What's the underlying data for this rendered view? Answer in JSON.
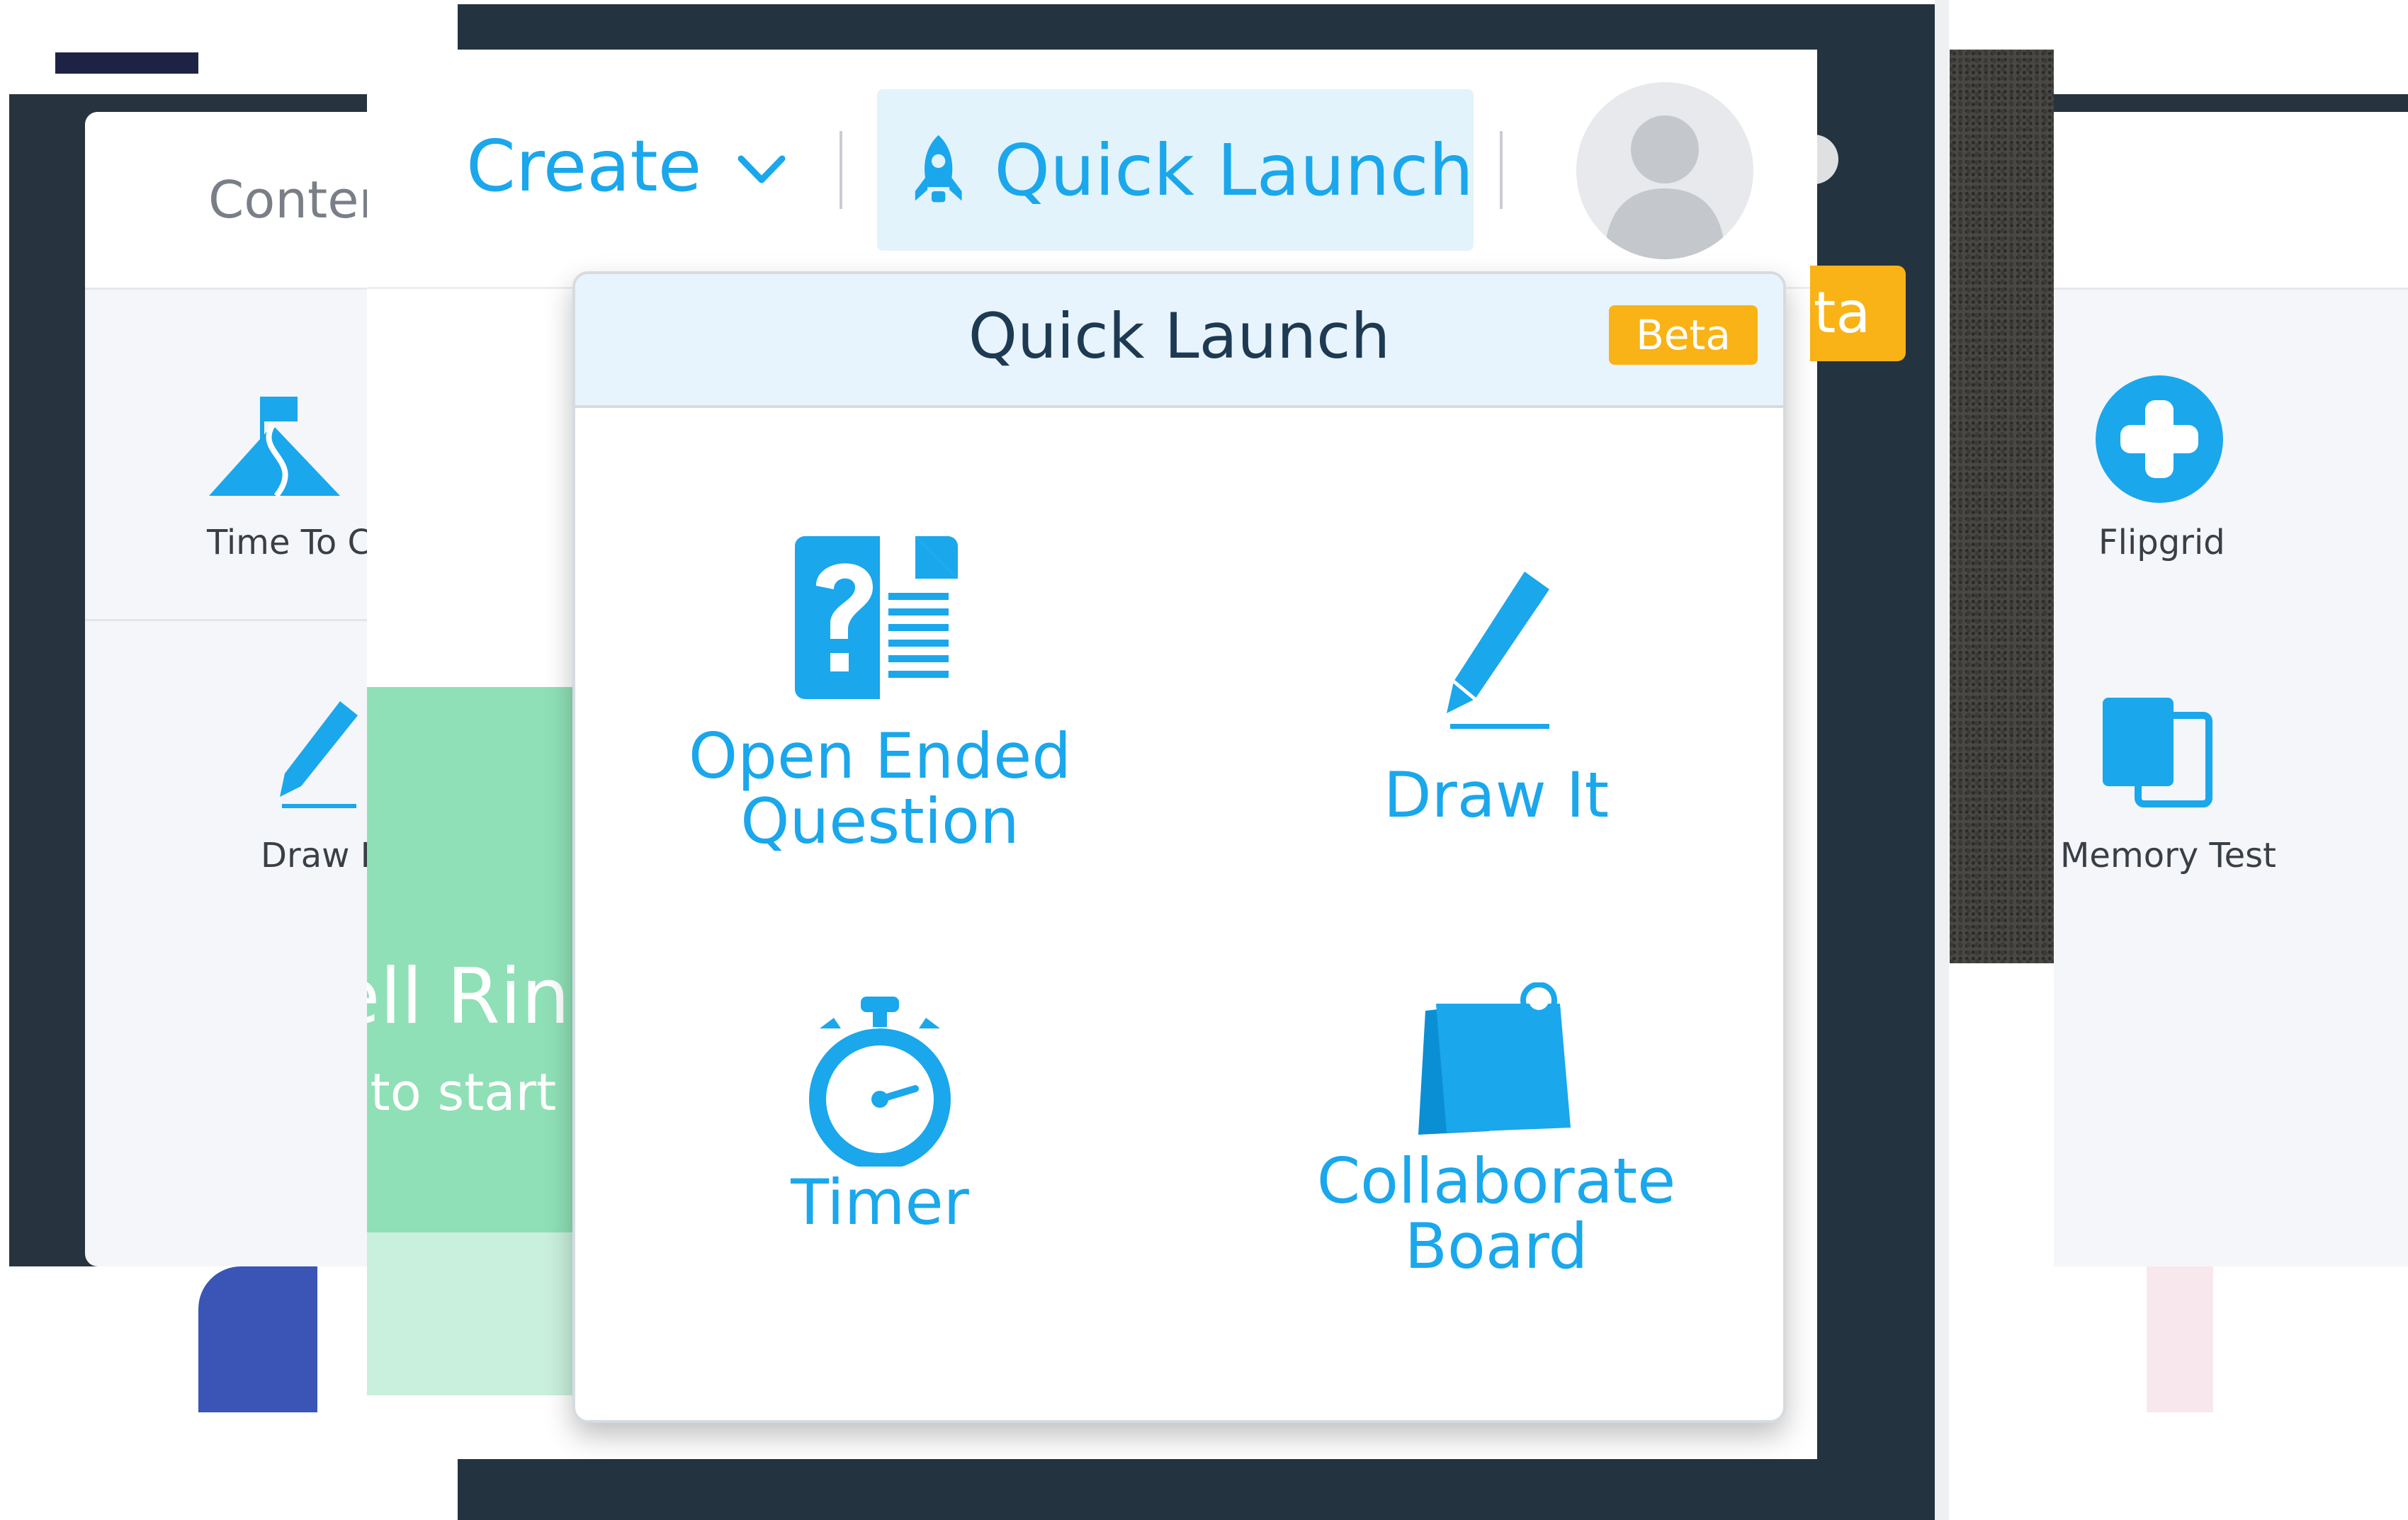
{
  "header": {
    "create_label": "Create",
    "quick_launch_label": "Quick Launch"
  },
  "background": {
    "left_tab_label": "Conter",
    "left_tiles": [
      "Time To Cl",
      "Draw It"
    ],
    "right_tiles": [
      "Flipgrid",
      "Memory Test"
    ],
    "bell_title": "ell Ring",
    "bell_subtitle": "r to start",
    "orange_text": "ta",
    "close_glyph": "×"
  },
  "dropdown": {
    "title": "Quick Launch",
    "badge": "Beta",
    "items": [
      {
        "label": "Open Ended\nQuestion",
        "icon": "question-document-icon"
      },
      {
        "label": "Draw It",
        "icon": "pencil-icon"
      },
      {
        "label": "Timer",
        "icon": "stopwatch-icon"
      },
      {
        "label": "Collaborate\nBoard",
        "icon": "pinned-board-icon"
      }
    ]
  },
  "colors": {
    "accent": "#1aa7ec",
    "badge": "#f9b316",
    "dark_bg": "#233340",
    "green_card": "#8fe0b6"
  }
}
